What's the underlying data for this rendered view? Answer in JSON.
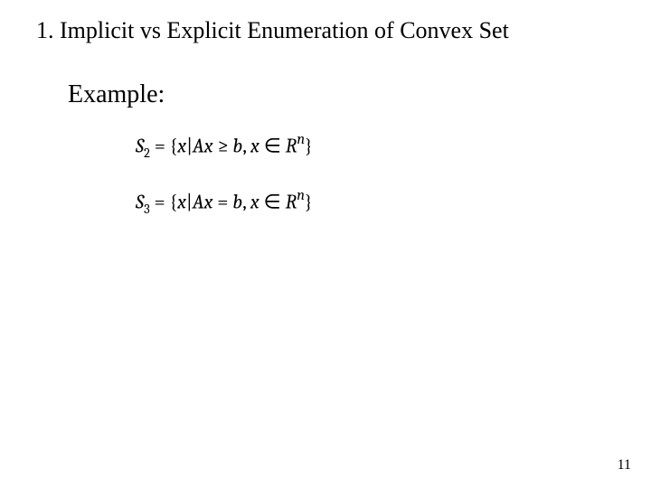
{
  "heading": "1. Implicit vs Explicit Enumeration of Convex Set",
  "example_label": "Example:",
  "formulas": {
    "s2": {
      "lhs_var": "S",
      "lhs_sub": "2",
      "eq": " = ",
      "lbrace": "{",
      "x1": "x",
      "bar": "|",
      "Ax": "Ax",
      "rel": " ≥ ",
      "b": "b",
      "comma": ", ",
      "x2": "x",
      "in": " ∈ ",
      "R": "R",
      "sup": "n",
      "rbrace": "}"
    },
    "s3": {
      "lhs_var": "S",
      "lhs_sub": "3",
      "eq": " = ",
      "lbrace": "{",
      "x1": "x",
      "bar": "|",
      "Ax": "Ax",
      "rel": " = ",
      "b": "b",
      "comma": ", ",
      "x2": "x",
      "in": " ∈ ",
      "R": "R",
      "sup": "n",
      "rbrace": "}"
    }
  },
  "page_number": "11"
}
